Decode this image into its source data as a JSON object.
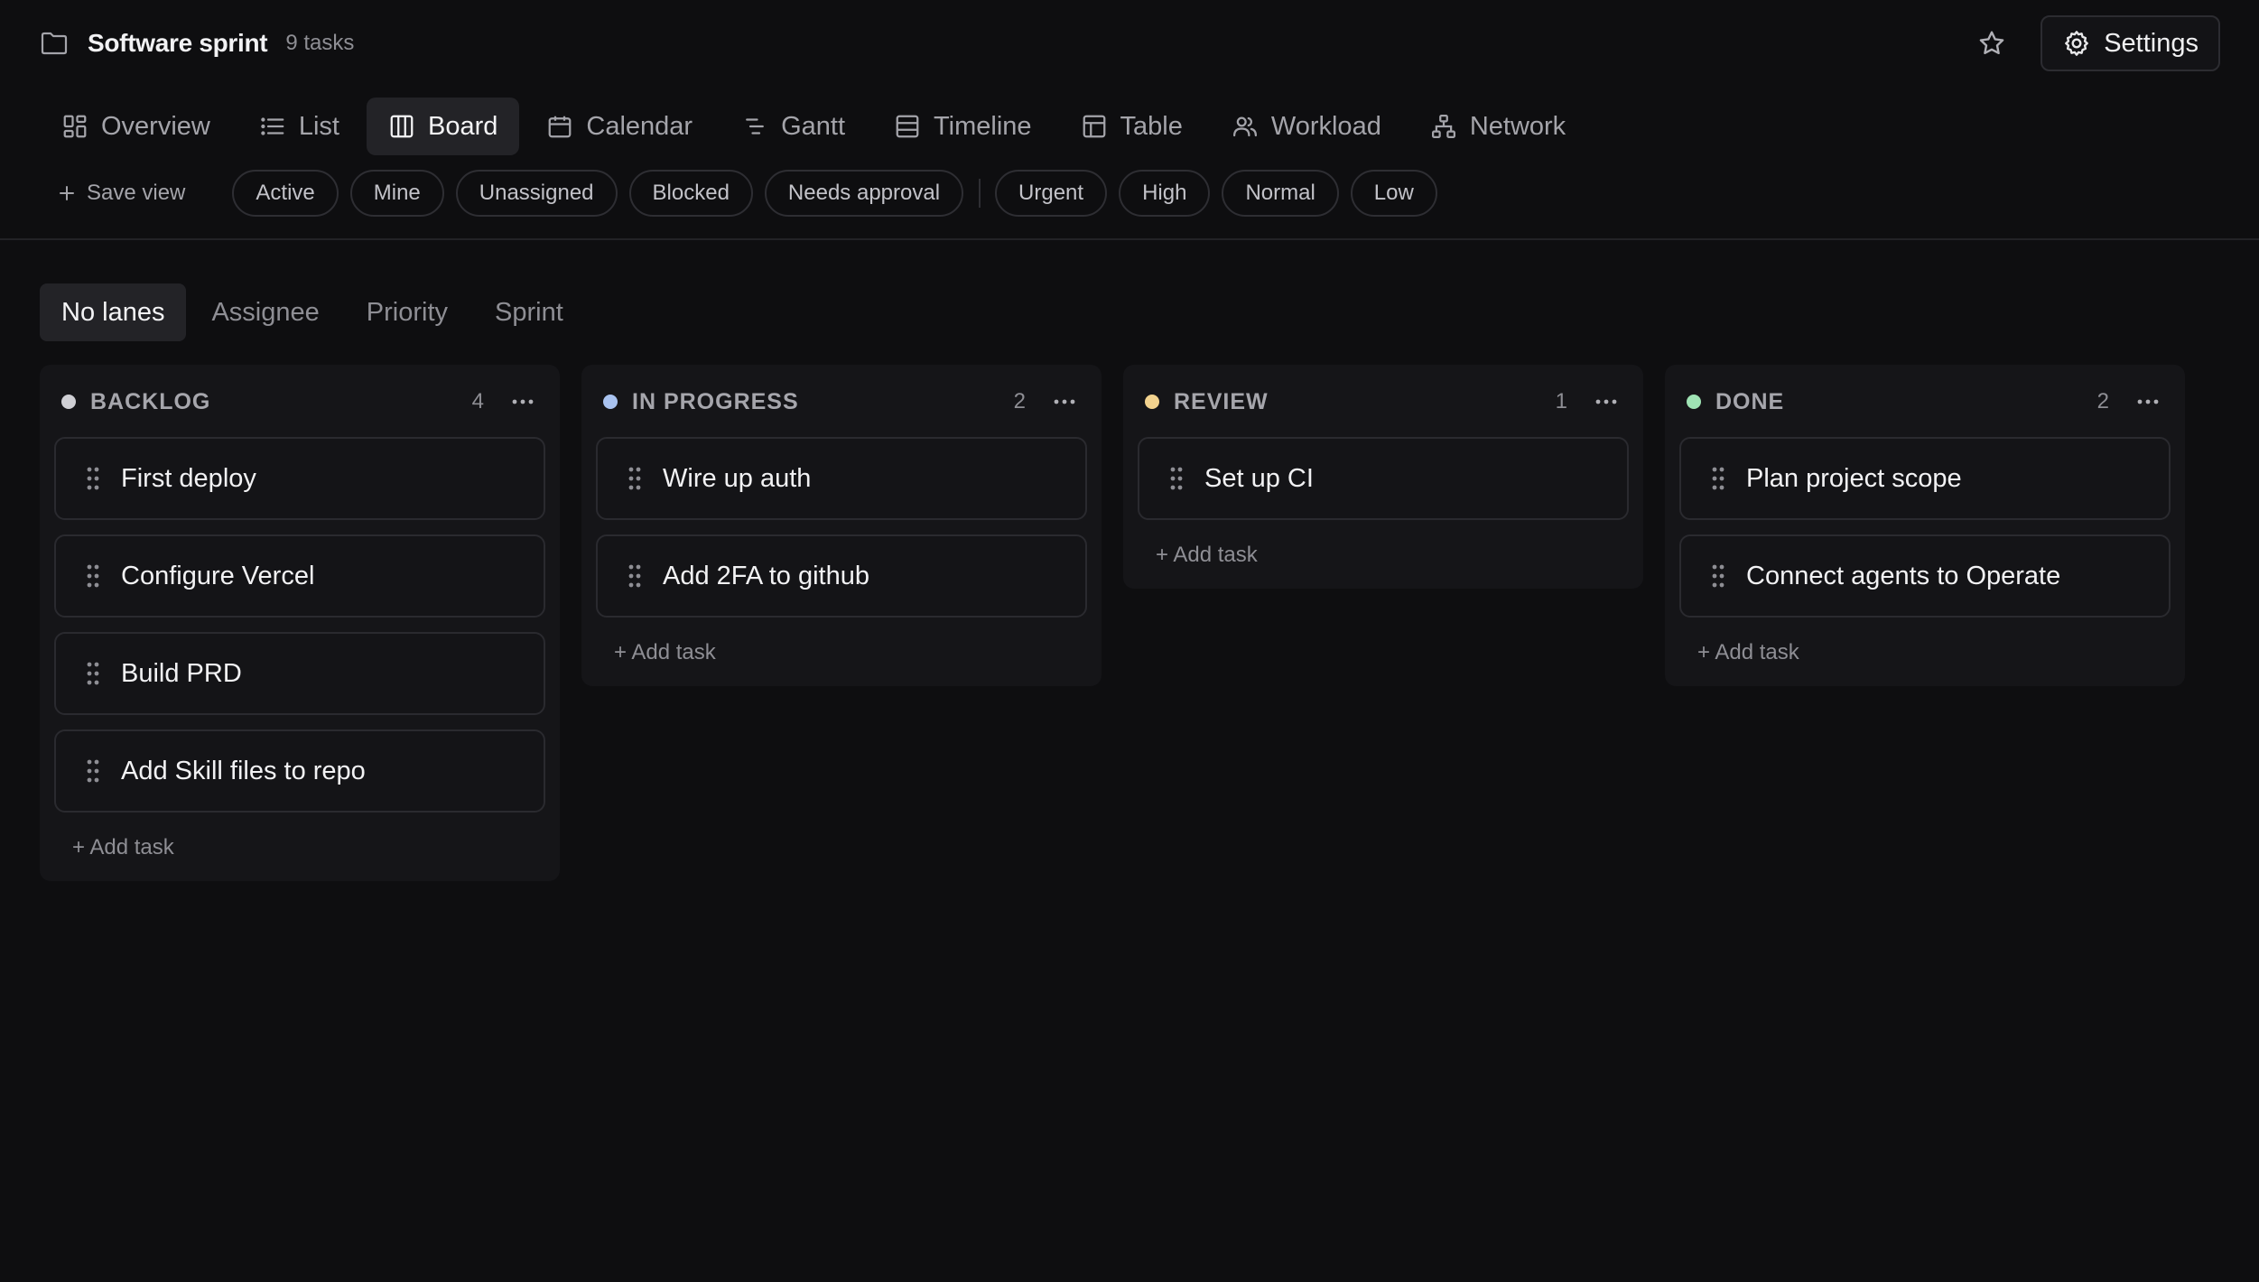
{
  "header": {
    "title": "Software sprint",
    "task_count": "9 tasks",
    "settings_label": "Settings"
  },
  "view_tabs": [
    {
      "label": "Overview",
      "icon": "grid-icon"
    },
    {
      "label": "List",
      "icon": "list-icon"
    },
    {
      "label": "Board",
      "icon": "columns-icon",
      "active": true
    },
    {
      "label": "Calendar",
      "icon": "calendar-icon"
    },
    {
      "label": "Gantt",
      "icon": "gantt-icon"
    },
    {
      "label": "Timeline",
      "icon": "timeline-icon"
    },
    {
      "label": "Table",
      "icon": "table-icon"
    },
    {
      "label": "Workload",
      "icon": "users-icon"
    },
    {
      "label": "Network",
      "icon": "network-icon"
    }
  ],
  "filters": {
    "save_view": "Save view",
    "status_chips": [
      "Active",
      "Mine",
      "Unassigned",
      "Blocked",
      "Needs approval"
    ],
    "priority_chips": [
      "Urgent",
      "High",
      "Normal",
      "Low"
    ]
  },
  "lane_tabs": [
    {
      "label": "No lanes",
      "active": true
    },
    {
      "label": "Assignee"
    },
    {
      "label": "Priority"
    },
    {
      "label": "Sprint"
    }
  ],
  "columns": [
    {
      "title": "BACKLOG",
      "count": "4",
      "color": "#cfcfd4",
      "cards": [
        "First deploy",
        "Configure Vercel",
        "Build PRD",
        "Add Skill files to repo"
      ]
    },
    {
      "title": "IN PROGRESS",
      "count": "2",
      "color": "#a9c3f0",
      "cards": [
        "Wire up auth",
        "Add 2FA to github"
      ]
    },
    {
      "title": "REVIEW",
      "count": "1",
      "color": "#f2d28e",
      "cards": [
        "Set up CI"
      ]
    },
    {
      "title": "DONE",
      "count": "2",
      "color": "#9fe3b4",
      "cards": [
        "Plan project scope",
        "Connect agents to Operate"
      ]
    }
  ],
  "add_task_label": "+ Add task"
}
